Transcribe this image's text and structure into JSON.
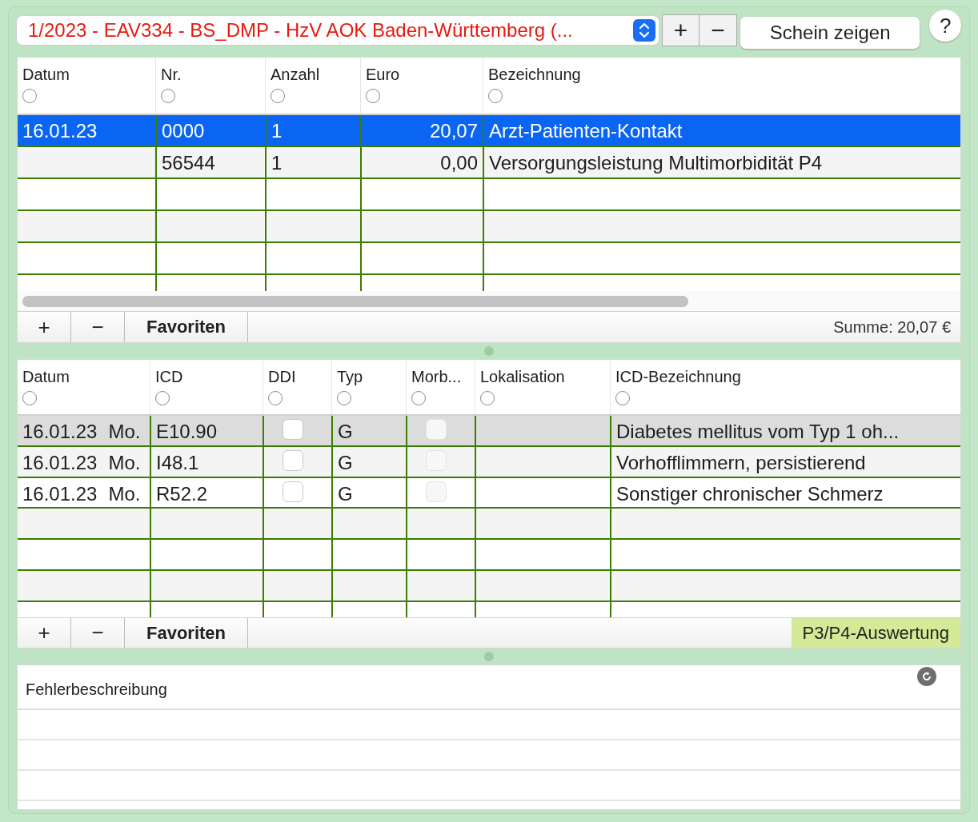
{
  "header": {
    "case_select": "1/2023 - EAV334 - BS_DMP - HzV AOK Baden-Württemberg (...",
    "add": "+",
    "remove": "−",
    "show_button": "Schein zeigen",
    "help": "?"
  },
  "services": {
    "columns": [
      "Datum",
      "Nr.",
      "Anzahl",
      "Euro",
      "Bezeichnung"
    ],
    "rows": [
      {
        "datum": "16.01.23",
        "nr": "0000",
        "anzahl": "1",
        "euro": "20,07",
        "bezeichnung": "Arzt-Patienten-Kontakt",
        "selected": true
      },
      {
        "nr": "56544",
        "anzahl": "1",
        "euro": "0,00",
        "bezeichnung": "Versorgungsleistung Multimorbidität P4",
        "selected": false
      }
    ],
    "footer": {
      "add": "+",
      "remove": "−",
      "favorites": "Favoriten",
      "total": "Summe: 20,07 €"
    }
  },
  "diagnoses": {
    "columns": [
      "Datum",
      "ICD",
      "DDI",
      "Typ",
      "Morb...",
      "Lokalisation",
      "ICD-Bezeichnung"
    ],
    "rows": [
      {
        "datum": "16.01.23",
        "weekday": "Mo.",
        "icd": "E10.90",
        "ddi": {
          "checked": false,
          "disabled": false
        },
        "typ": "G",
        "morbi": {
          "checked": false,
          "disabled": true
        },
        "bezeichnung": "Diabetes mellitus vom Typ 1 oh...",
        "selected": true
      },
      {
        "datum": "16.01.23",
        "weekday": "Mo.",
        "icd": "I48.1",
        "ddi": {
          "checked": false,
          "disabled": false
        },
        "typ": "G",
        "morbi": {
          "checked": false,
          "disabled": true
        },
        "bezeichnung": "Vorhofflimmern, persistierend",
        "selected": false
      },
      {
        "datum": "16.01.23",
        "weekday": "Mo.",
        "icd": "R52.2",
        "ddi": {
          "checked": false,
          "disabled": false
        },
        "typ": "G",
        "morbi": {
          "checked": false,
          "disabled": true
        },
        "bezeichnung": "Sonstiger chronischer Schmerz",
        "selected": false
      }
    ],
    "footer": {
      "add": "+",
      "remove": "−",
      "favorites": "Favoriten",
      "evaluation": "P3/P4-Auswertung"
    }
  },
  "errors": {
    "title": "Fehlerbeschreibung"
  }
}
